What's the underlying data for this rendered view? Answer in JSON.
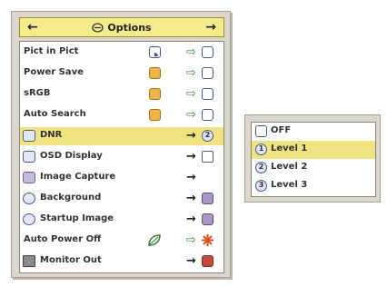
{
  "menu": {
    "title": "Options",
    "rows": [
      {
        "label": "Pict in Pict",
        "value": ""
      },
      {
        "label": "Power Save",
        "value": ""
      },
      {
        "label": "sRGB",
        "value": ""
      },
      {
        "label": "Auto Search",
        "value": ""
      },
      {
        "label": "DNR",
        "value": "2"
      },
      {
        "label": "OSD Display",
        "value": ""
      },
      {
        "label": "Image Capture",
        "value": ""
      },
      {
        "label": "Background",
        "value": ""
      },
      {
        "label": "Startup Image",
        "value": ""
      },
      {
        "label": "Auto Power Off",
        "value": ""
      },
      {
        "label": "Monitor Out",
        "value": ""
      }
    ],
    "selected_index": 4
  },
  "dnr_submenu": {
    "items": [
      {
        "label": "OFF",
        "icon": ""
      },
      {
        "label": "Level 1",
        "icon": "1"
      },
      {
        "label": "Level 2",
        "icon": "2"
      },
      {
        "label": "Level 3",
        "icon": "3"
      }
    ],
    "selected_index": 1
  },
  "colors": {
    "highlight": "#f1e37f",
    "panel": "#dcd7cd",
    "icon_border": "#465c96",
    "arrow_green": "#3f8e41"
  }
}
